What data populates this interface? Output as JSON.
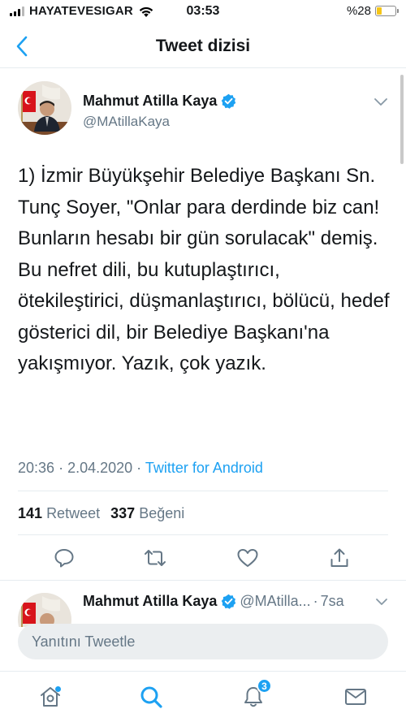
{
  "status_bar": {
    "carrier": "HAYATEVESIGAR",
    "time": "03:53",
    "battery": "%28",
    "battery_level": 0.28
  },
  "header": {
    "title": "Tweet dizisi",
    "back_icon": "chevron-left-icon"
  },
  "tweet": {
    "author_name": "Mahmut Atilla Kaya",
    "author_handle": "@MAtillaKaya",
    "text": "1) İzmir Büyükşehir Belediye Başkanı Sn. Tunç Soyer, \"Onlar para derdinde biz can! Bunların hesabı bir gün sorulacak\" demiş. Bu nefret dili, bu kutuplaştırıcı, ötekileştirici, düşmanlaştırıcı, bölücü, hedef gösterici dil, bir Belediye Başkanı'na yakışmıyor. Yazık, çok yazık.",
    "time": "20:36",
    "date": "2.04.2020",
    "source": "Twitter for Android",
    "retweet_count": "141",
    "retweet_label": "Retweet",
    "like_count": "337",
    "like_label": "Beğeni"
  },
  "reply_preview": {
    "author_name": "Mahmut Atilla Kaya",
    "handle": "@MAtilla...",
    "time": "7sa"
  },
  "composer": {
    "placeholder": "Yanıtını Tweetle"
  },
  "tab_bar": {
    "notification_count": "3"
  },
  "colors": {
    "accent": "#1da1f2",
    "text_primary": "#14171a",
    "text_secondary": "#657786"
  }
}
